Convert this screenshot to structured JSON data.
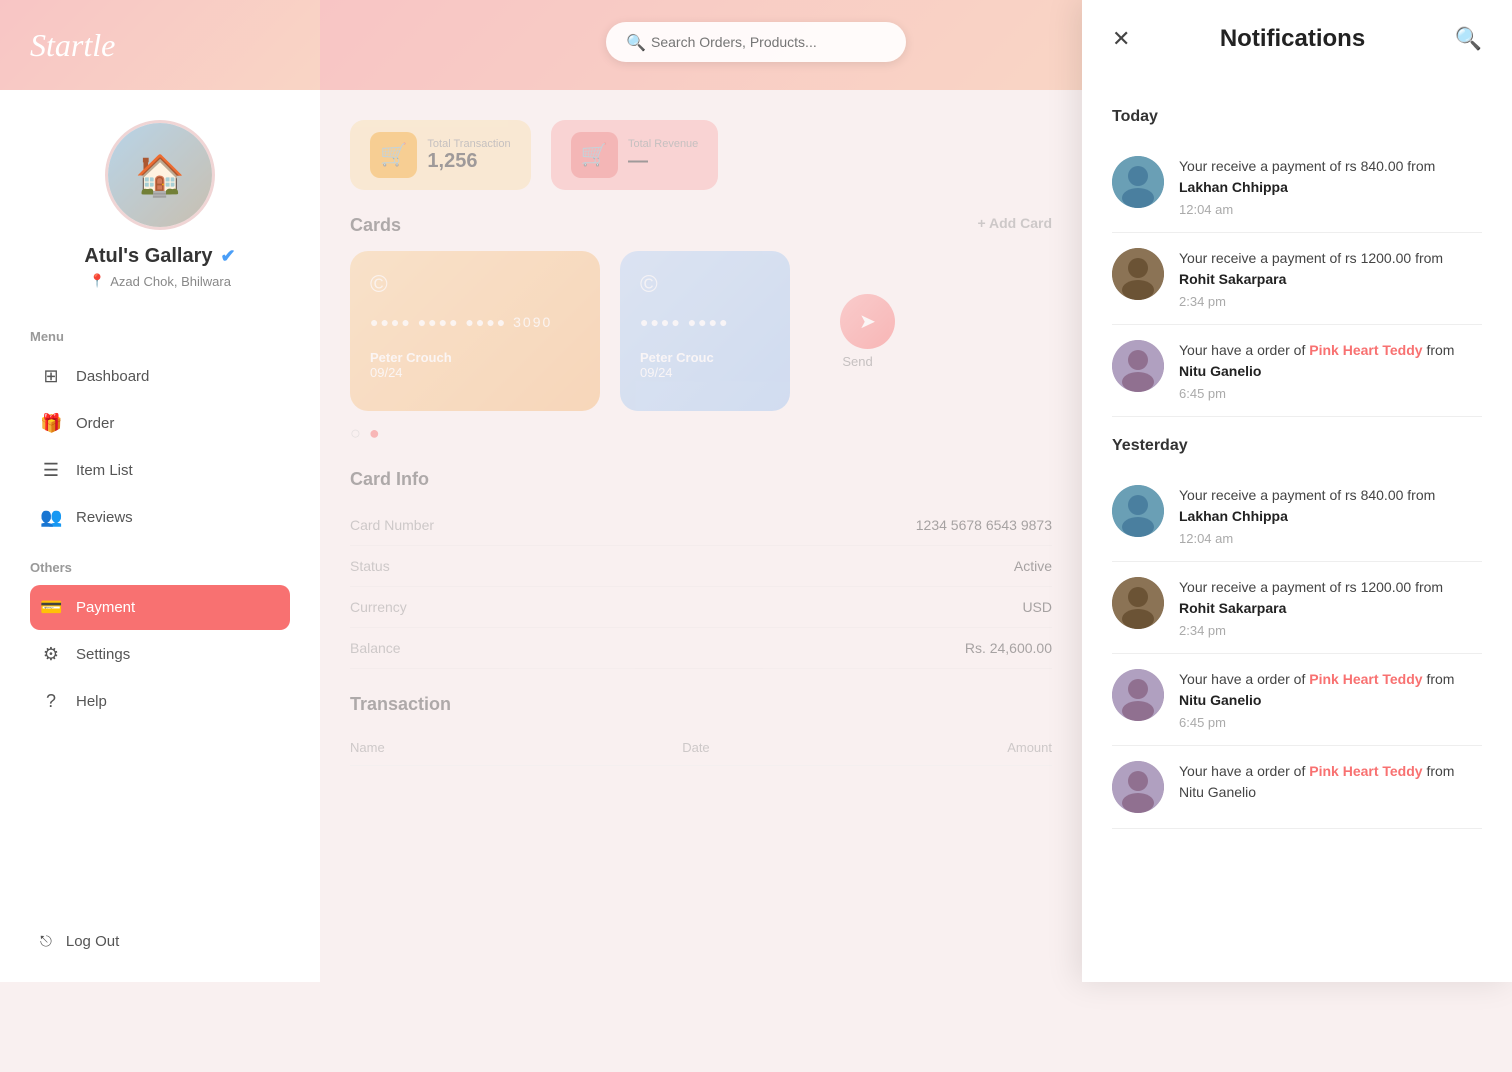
{
  "app": {
    "name": "Startle",
    "search_placeholder": "Search Orders, Products..."
  },
  "sidebar": {
    "menu_label": "Menu",
    "others_label": "Others",
    "shop_name": "Atul's Gallary",
    "shop_location": "Azad Chok, Bhilwara",
    "menu_items": [
      {
        "id": "dashboard",
        "label": "Dashboard",
        "icon": "⊞"
      },
      {
        "id": "order",
        "label": "Order",
        "icon": "🎁"
      },
      {
        "id": "item-list",
        "label": "Item List",
        "icon": "☰"
      },
      {
        "id": "reviews",
        "label": "Reviews",
        "icon": "👥"
      }
    ],
    "others_items": [
      {
        "id": "payment",
        "label": "Payment",
        "icon": "💳",
        "active": true
      },
      {
        "id": "settings",
        "label": "Settings",
        "icon": "⚙"
      },
      {
        "id": "help",
        "label": "Help",
        "icon": "?"
      }
    ],
    "logout_label": "Log Out",
    "logout_icon": "⎋"
  },
  "stats": {
    "total_transaction_label": "Total Transaction",
    "total_transaction_value": "1,256"
  },
  "cards": {
    "section_title": "Cards",
    "add_card_label": "+ Add Card",
    "send_label": "Send",
    "cards": [
      {
        "number": "●●●● ●●●● ●●●● 3090",
        "holder": "Peter Crouch",
        "expiry": "09/24",
        "style": "orange"
      },
      {
        "number": "●●●● ●●●●",
        "holder": "Peter Crouc",
        "expiry": "09/24",
        "style": "blue"
      }
    ],
    "card_info_title": "Card Info",
    "card_number_label": "Card Number",
    "card_number_value": "1234 5678 6543 9873",
    "status_label": "Status",
    "status_value": "Active",
    "currency_label": "Currency",
    "currency_value": "USD",
    "balance_label": "Balance",
    "balance_value": "Rs. 24,600.00"
  },
  "transaction": {
    "section_title": "Transaction",
    "columns": [
      "Name",
      "Date",
      "Amount"
    ]
  },
  "notifications": {
    "panel_title": "Notifications",
    "today_label": "Today",
    "yesterday_label": "Yesterday",
    "today_items": [
      {
        "avatar_class": "av-man1",
        "avatar_emoji": "👨",
        "message": "Your receive a payment of rs 840.00 from ",
        "bold": "Lakhan Chhippa",
        "time": "12:04 am",
        "link": null
      },
      {
        "avatar_class": "av-man2",
        "avatar_emoji": "👨",
        "message": "Your receive a payment of rs 1200.00 from ",
        "bold": "Rohit Sakarpara",
        "time": "2:34 pm",
        "link": null
      },
      {
        "avatar_class": "av-woman1",
        "avatar_emoji": "👩",
        "message": "Your have a order of ",
        "link_text": "Pink Heart Teddy",
        "link_after": " from ",
        "bold": "Nitu Ganelio",
        "time": "6:45 pm",
        "link": "Pink Heart Teddy"
      }
    ],
    "yesterday_items": [
      {
        "avatar_class": "av-man1",
        "avatar_emoji": "👨",
        "message": "Your receive a payment of rs 840.00 from ",
        "bold": "Lakhan Chhippa",
        "time": "12:04 am",
        "link": null
      },
      {
        "avatar_class": "av-man2",
        "avatar_emoji": "👨",
        "message": "Your receive a payment of rs 1200.00 from ",
        "bold": "Rohit Sakarpara",
        "time": "2:34 pm",
        "link": null
      },
      {
        "avatar_class": "av-woman1",
        "avatar_emoji": "👩",
        "message": "Your have a order of ",
        "link_text": "Pink Heart Teddy",
        "link_after": " from ",
        "bold": "Nitu Ganelio",
        "time": "6:45 pm",
        "link": "Pink Heart Teddy"
      },
      {
        "avatar_class": "av-woman1",
        "avatar_emoji": "👩",
        "message": "Your have a order of ",
        "link_text": "Pink Heart Teddy",
        "link_after": " from Nitu Ganelio",
        "bold": "",
        "time": "",
        "link": "Pink Heart Teddy"
      }
    ]
  }
}
